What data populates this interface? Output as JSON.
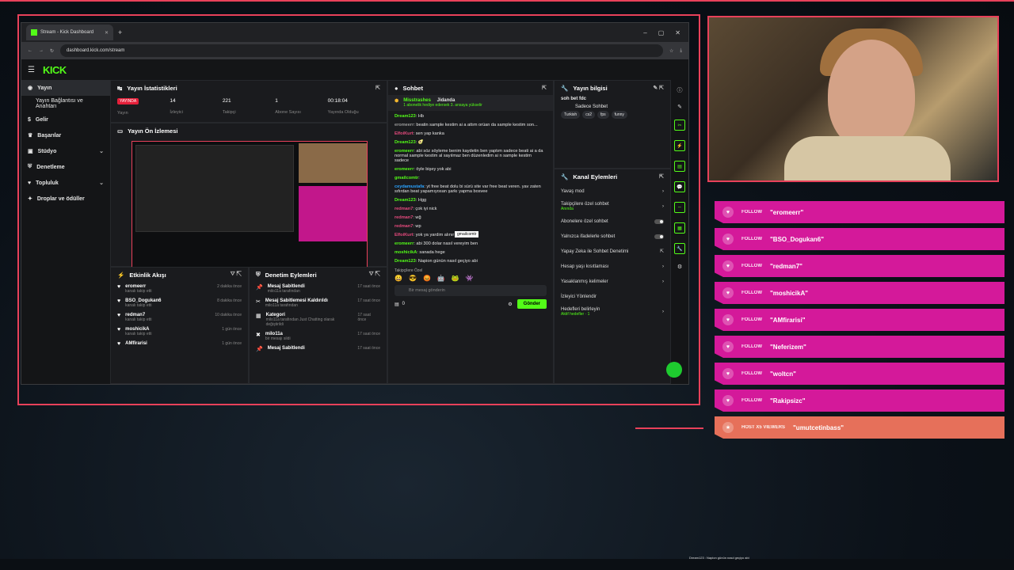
{
  "browser": {
    "tab_title": "Stream - Kick Dashboard",
    "url": "dashboard.kick.com/stream"
  },
  "app": {
    "logo": "KICK"
  },
  "sidebar": {
    "items": [
      {
        "label": "Yayın",
        "icon": "broadcast-icon"
      },
      {
        "label": "Yayın Bağlantısı ve Anahtarı",
        "icon": ""
      },
      {
        "label": "Gelir",
        "icon": "dollar-icon"
      },
      {
        "label": "Başarılar",
        "icon": "trophy-icon"
      },
      {
        "label": "Stüdyo",
        "icon": "studio-icon"
      },
      {
        "label": "Denetleme",
        "icon": "shield-icon"
      },
      {
        "label": "Topluluk",
        "icon": "community-icon"
      },
      {
        "label": "Droplar ve ödüller",
        "icon": "gift-icon"
      }
    ]
  },
  "stats": {
    "title": "Yayın İstatistikleri",
    "live_badge": "YAYINDA",
    "live_label": "Yayın",
    "viewers": "14",
    "viewers_label": "İzleyici",
    "followers": "221",
    "followers_label": "Takipçi",
    "subs": "1",
    "subs_label": "Abone Sayısı",
    "uptime": "00:18:04",
    "uptime_label": "Yayında Olduğu"
  },
  "preview": {
    "title": "Yayın Ön İzlemesi"
  },
  "activity": {
    "title": "Etkinlik Akışı",
    "items": [
      {
        "name": "eromeerr",
        "sub": "kanalı takip etti",
        "time": "2 dakika önce"
      },
      {
        "name": "BSO_Dogukan6",
        "sub": "kanalı takip etti",
        "time": "8 dakika önce"
      },
      {
        "name": "redman7",
        "sub": "kanalı takip etti",
        "time": "10 dakika önce"
      },
      {
        "name": "moshicikA",
        "sub": "kanalı takip etti",
        "time": "1 gün önce"
      },
      {
        "name": "AMfirarisi",
        "sub": "",
        "time": "1 gün önce"
      }
    ]
  },
  "modlog": {
    "title": "Denetim Eylemleri",
    "items": [
      {
        "name": "Mesaj Sabitlendi",
        "sub": "milo11a tarafından",
        "time": "17 saat önce"
      },
      {
        "name": "Mesaj Sabitlemesi Kaldırıldı",
        "sub": "milo11a tarafından",
        "time": "17 saat önce"
      },
      {
        "name": "Kategori",
        "sub": "milo11a tarafından Just Chatting olarak değiştirildi",
        "time": "17 saat önce"
      },
      {
        "name": "milo11a",
        "sub": "bir mesajı sildi",
        "time": "17 saat önce"
      },
      {
        "name": "Mesaj Sabitlendi",
        "sub": "",
        "time": "17 saat önce"
      }
    ]
  },
  "chat": {
    "title": "Sohbet",
    "pinned_user": "Misstrashes",
    "pinned_target": "Jidanda",
    "pinned_text": "1 abonelik hediye edersek 3. ansaya yükselir",
    "messages": [
      {
        "user": "Dream123",
        "text": ": Hb",
        "cls": "b"
      },
      {
        "user": "eromeerr",
        "text": ": beatin sample kestim ai a attım orüan da sample kestim son...",
        "cls": "gr"
      },
      {
        "user": "ElfoiKurt",
        "text": ": sen yap kanka",
        "cls": "pk"
      },
      {
        "user": "Dream123",
        "text": ": 🥑",
        "cls": "b"
      },
      {
        "user": "eromeerr",
        "text": ": abi söz söyleme benim kaydetin ben yaptım sadece beati ai a da normal sample kestim al sayılmaz ben düzenledim ai n sample kestim sadece",
        "cls": "b"
      },
      {
        "user": "eromeerr",
        "text": ": öyle bişey yok abi",
        "cls": "b"
      },
      {
        "user": "gmailcomtr",
        "text": ":",
        "cls": "b"
      },
      {
        "user": "ceydamustafa",
        "text": ": yt free beat dolu bi sürü site var free beat veren. yav zaten sıfırdan beat yapamıyosan şarkı yapma bosvee",
        "cls": "bl"
      },
      {
        "user": "Dream123",
        "text": ": Hgg",
        "cls": "b"
      },
      {
        "user": "redman7",
        "text": ": çok iyi nick",
        "cls": "pk"
      },
      {
        "user": "redman7",
        "text": ": wğ",
        "cls": "pk"
      },
      {
        "user": "redman7",
        "text": ": wp",
        "cls": "pk"
      },
      {
        "user": "ElfoiKurt",
        "text": ": yok ya yardim alınır al dan",
        "cls": "pk"
      },
      {
        "user": "eromeerr",
        "text": ": abi 300 dolar nasıl vereyim ben",
        "cls": "b"
      },
      {
        "user": "moshicikA",
        "text": ": sanada hege",
        "cls": "b"
      },
      {
        "user": "Dream123",
        "text": ": Napion günün nasıl geçiyo abi",
        "cls": "b"
      }
    ],
    "tooltip": "gmailcomtr",
    "followers_only": "Takipçilere Özel",
    "input_placeholder": "Bir mesaj gönderin",
    "count": "0",
    "send": "Gönder"
  },
  "info": {
    "title": "Yayın bilgisi",
    "stream_title": "soh bet fdc",
    "category": "Sadece Sohbet",
    "tags": [
      "Turkish",
      "cs2",
      "fps",
      "funny"
    ]
  },
  "actions": {
    "title": "Kanal Eylemleri",
    "items": [
      {
        "label": "Yavaş mod",
        "type": "chev"
      },
      {
        "label": "Takipçilere özel sohbet",
        "sub": "Anında",
        "type": "chev"
      },
      {
        "label": "Abonelere özel sohbet",
        "type": "toggle"
      },
      {
        "label": "Yalnızca ifadelerle sohbet",
        "type": "toggle"
      },
      {
        "label": "Yapay Zeka ile Sohbet Denetimi",
        "type": "ext"
      },
      {
        "label": "Hesap yaşı kısıtlaması",
        "type": "chev"
      },
      {
        "label": "Yasaklanmış kelimeler",
        "type": "chev"
      },
      {
        "label": "İzleyici Yönlendir",
        "type": "none"
      },
      {
        "label": "Hedefleri belirleyin",
        "sub": "Aktif hedefler · 1",
        "type": "chev"
      }
    ]
  },
  "alerts": [
    {
      "label": "FOLLOW",
      "name": "\"eromeerr\""
    },
    {
      "label": "FOLLOW",
      "name": "\"BSO_Dogukan6\""
    },
    {
      "label": "FOLLOW",
      "name": "\"redman7\""
    },
    {
      "label": "FOLLOW",
      "name": "\"moshicikA\""
    },
    {
      "label": "FOLLOW",
      "name": "\"AMfirarisi\""
    },
    {
      "label": "FOLLOW",
      "name": "\"Neferizem\""
    },
    {
      "label": "FOLLOW",
      "name": "\"woltcn\""
    },
    {
      "label": "FOLLOW",
      "name": "\"Rakipsizc\""
    },
    {
      "label": "HOST X5 VIEWERS",
      "name": "\"umutcetinbass\""
    }
  ],
  "ticker": "Dream123 : Napion günün nasıl geçiyo abi",
  "colors": {
    "accent": "#53fc18",
    "frame": "#e8415a",
    "alert": "#d4199a",
    "host": "#e6705a"
  }
}
